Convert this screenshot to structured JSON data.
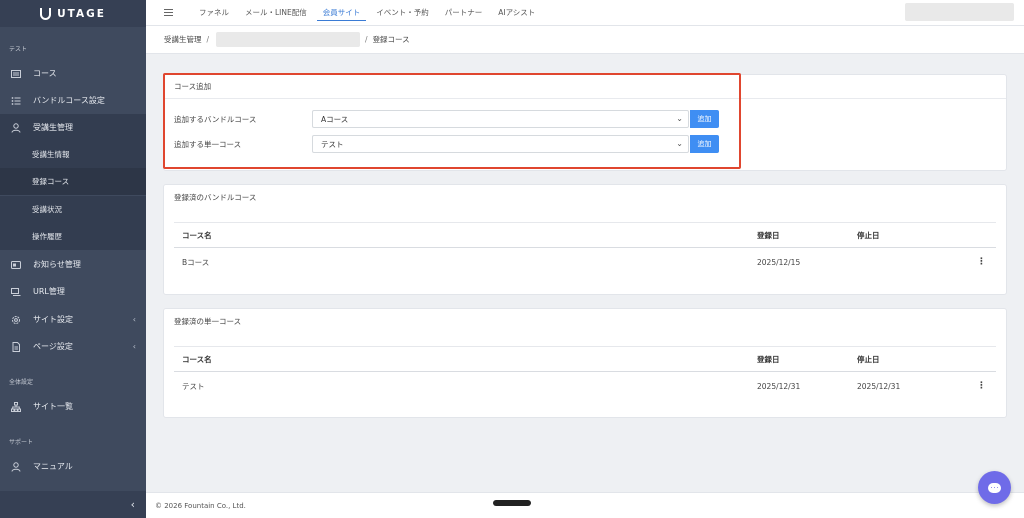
{
  "brand": {
    "logo_text": "UTAGE"
  },
  "sidebar": {
    "section_test": "テスト",
    "section_all": "全体設定",
    "section_support": "サポート",
    "items": [
      {
        "label": "コース",
        "icon": "course-icon"
      },
      {
        "label": "バンドルコース設定",
        "icon": "list-icon"
      },
      {
        "label": "受講生管理",
        "icon": "user-icon"
      },
      {
        "label": "お知らせ管理",
        "icon": "news-icon"
      },
      {
        "label": "URL管理",
        "icon": "url-icon"
      },
      {
        "label": "サイト設定",
        "icon": "gear-icon"
      },
      {
        "label": "ページ設定",
        "icon": "page-icon"
      },
      {
        "label": "サイト一覧",
        "icon": "sitemap-icon"
      },
      {
        "label": "マニュアル",
        "icon": "user-icon"
      }
    ],
    "sub_items": [
      "受講生情報",
      "登録コース",
      "受講状況",
      "操作履歴"
    ],
    "collapse": "‹"
  },
  "topbar": {
    "tabs": [
      "ファネル",
      "メール・LINE配信",
      "会員サイト",
      "イベント・予約",
      "パートナー",
      "AIアシスト"
    ],
    "active_tab": "会員サイト"
  },
  "breadcrumb": {
    "root": "受講生管理",
    "sep": "/",
    "current": "登録コース"
  },
  "add_course": {
    "title": "コース追加",
    "bundle_label": "追加するバンドルコース",
    "bundle_value": "Aコース",
    "single_label": "追加する単一コース",
    "single_value": "テスト",
    "add_label": "追加"
  },
  "bundle_table": {
    "title": "登録済のバンドルコース",
    "columns": [
      "コース名",
      "登録日",
      "停止日"
    ],
    "rows": [
      {
        "name": "Bコース",
        "registered": "2025/12/15",
        "stopped": ""
      }
    ]
  },
  "single_table": {
    "title": "登録済の単一コース",
    "columns": [
      "コース名",
      "登録日",
      "停止日"
    ],
    "rows": [
      {
        "name": "テスト",
        "registered": "2025/12/31",
        "stopped": "2025/12/31"
      }
    ]
  },
  "footer": {
    "copyright": "© 2026 Fountain Co., Ltd."
  },
  "colors": {
    "accent": "#3a7bd5",
    "button": "#3f8ef3",
    "highlight": "#e0462f",
    "sidebar": "#3f4a5e",
    "chat": "#6f6be8"
  }
}
